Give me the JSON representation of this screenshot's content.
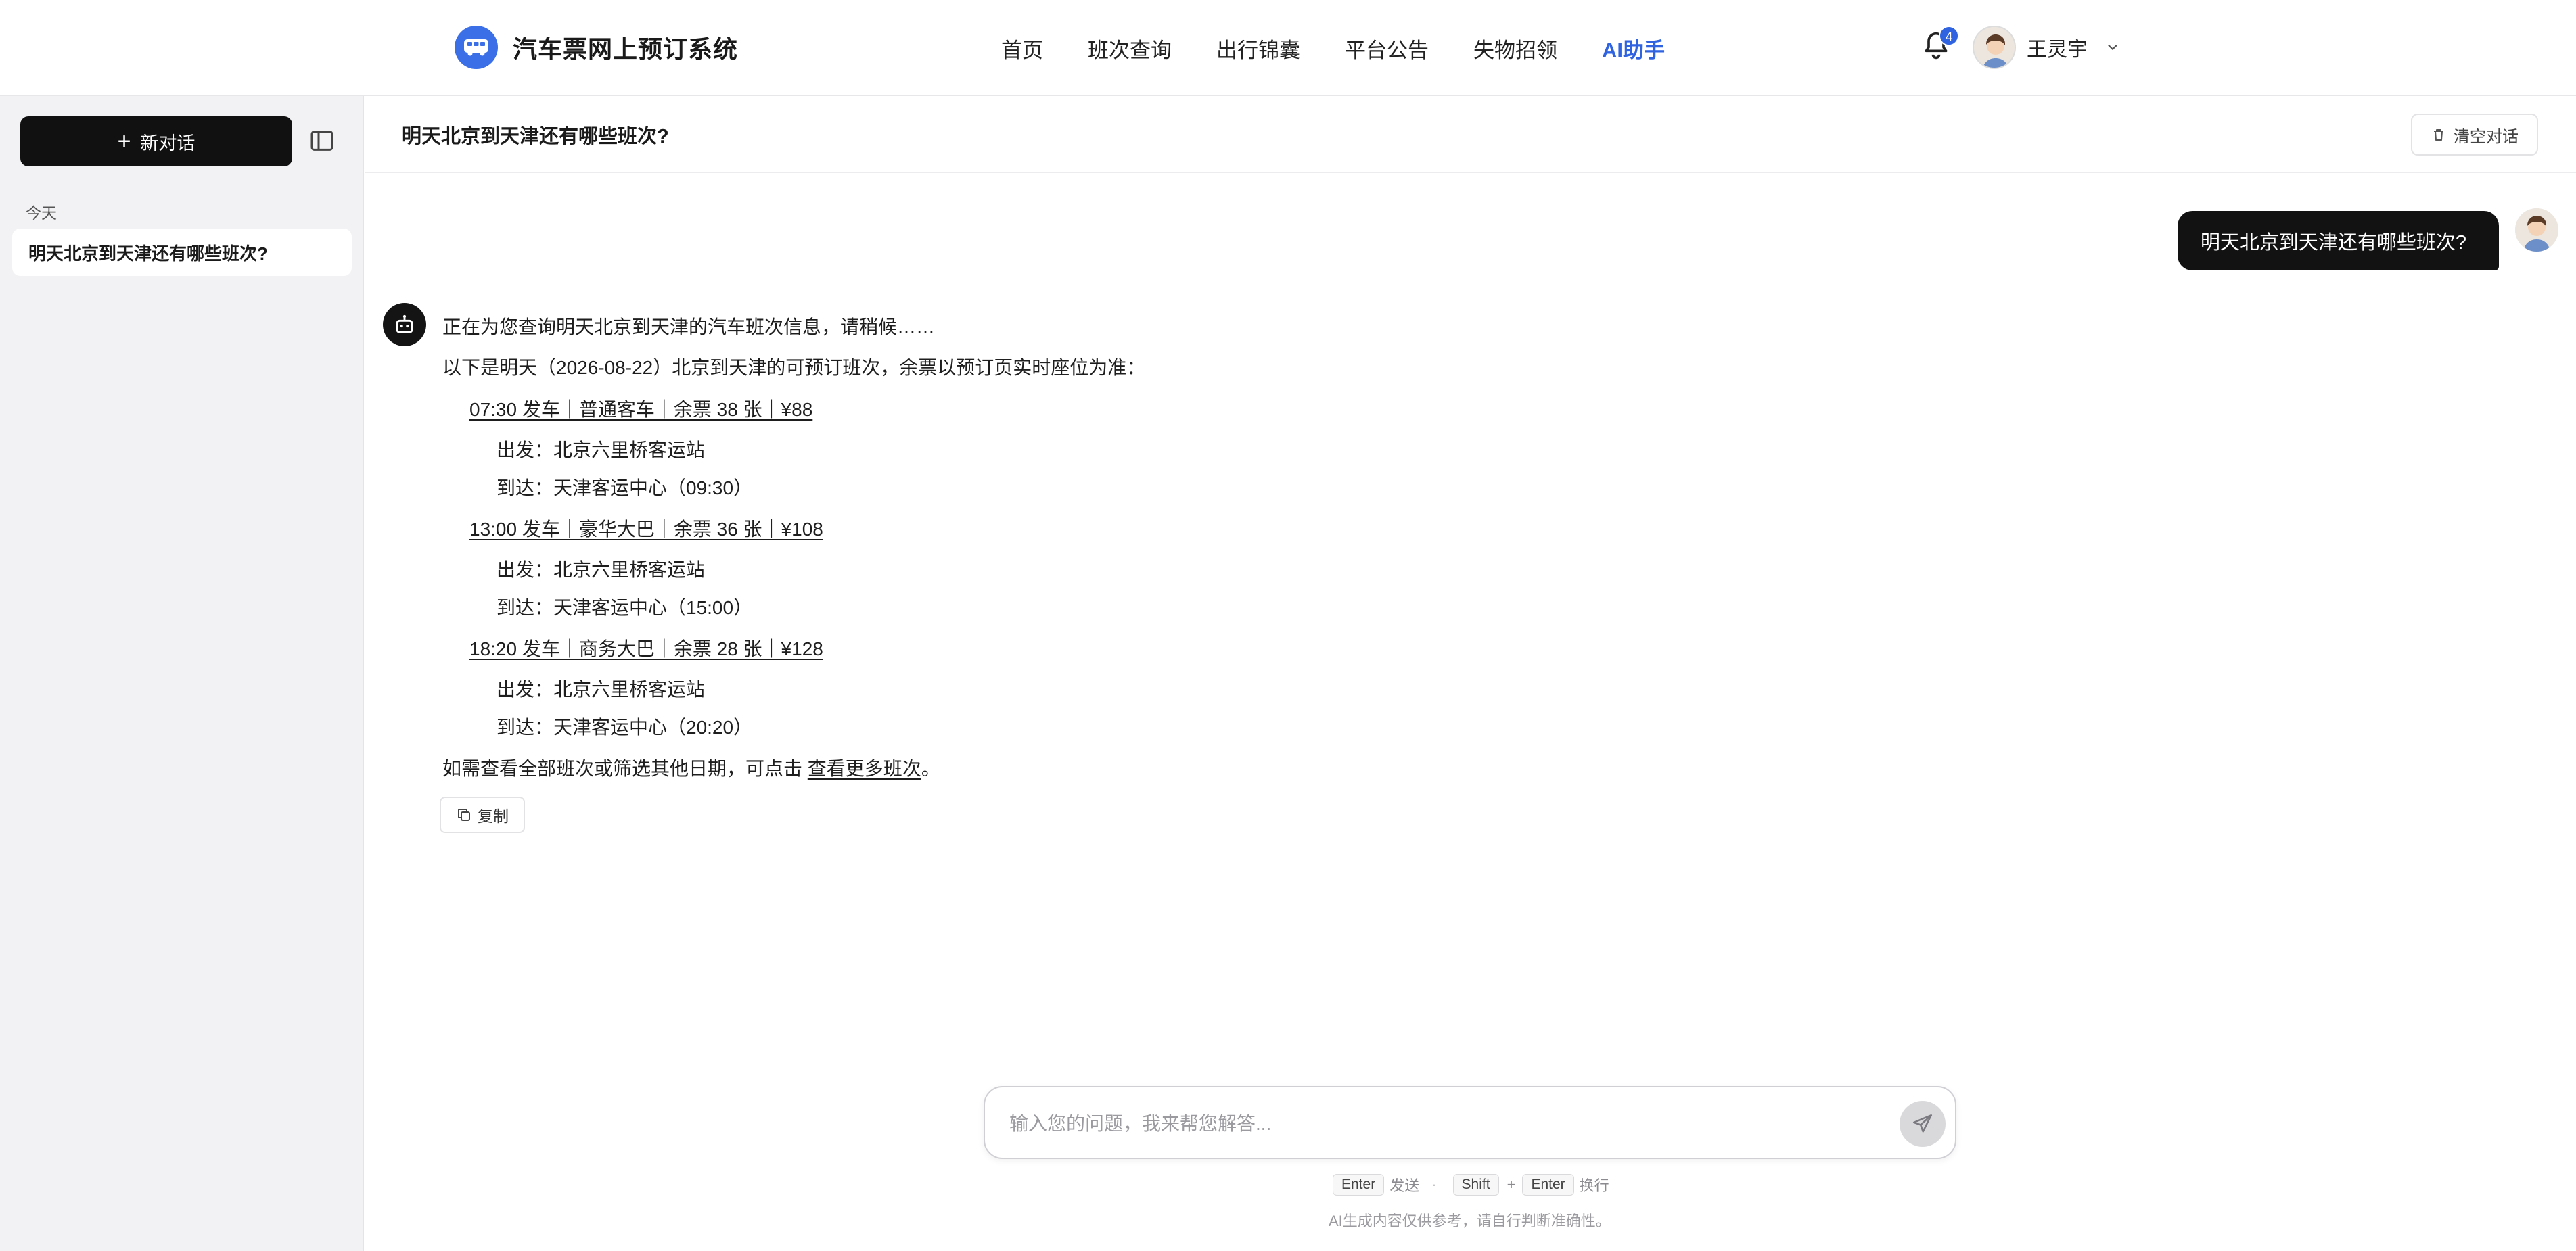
{
  "app": {
    "title": "汽车票网上预订系统"
  },
  "nav": {
    "items": [
      {
        "label": "首页",
        "active": false
      },
      {
        "label": "班次查询",
        "active": false
      },
      {
        "label": "出行锦囊",
        "active": false
      },
      {
        "label": "平台公告",
        "active": false
      },
      {
        "label": "失物招领",
        "active": false
      },
      {
        "label": "AI助手",
        "active": true
      }
    ],
    "notification_count": "4",
    "user_name": "王灵宇"
  },
  "sidebar": {
    "new_chat_label": "新对话",
    "group_label": "今天",
    "conversations": [
      {
        "title": "明天北京到天津还有哪些班次?"
      }
    ]
  },
  "chat": {
    "title": "明天北京到天津还有哪些班次?",
    "clear_label": "清空对话",
    "user_message": "明天北京到天津还有哪些班次?",
    "bot": {
      "status": "正在为您查询明天北京到天津的汽车班次信息，请稍候……",
      "intro": "以下是明天（2026-08-22）北京到天津的可预订班次，余票以预订页实时座位为准：",
      "trips": [
        {
          "summary": "07:30 发车｜普通客车｜余票 38 张｜¥88",
          "depart": "出发：北京六里桥客运站",
          "arrive": "到达：天津客运中心（09:30）"
        },
        {
          "summary": "13:00 发车｜豪华大巴｜余票 36 张｜¥108",
          "depart": "出发：北京六里桥客运站",
          "arrive": "到达：天津客运中心（15:00）"
        },
        {
          "summary": "18:20 发车｜商务大巴｜余票 28 张｜¥128",
          "depart": "出发：北京六里桥客运站",
          "arrive": "到达：天津客运中心（20:20）"
        }
      ],
      "outro_prefix": "如需查看全部班次或筛选其他日期，可点击 ",
      "outro_link": "查看更多班次",
      "outro_suffix": "。",
      "copy_label": "复制"
    }
  },
  "composer": {
    "placeholder": "输入您的问题，我来帮您解答...",
    "hint_enter_key": "Enter",
    "hint_send": "发送",
    "hint_shift_key": "Shift",
    "hint_plus": "+",
    "hint_newline": "换行",
    "disclaimer": "AI生成内容仅供参考，请自行判断准确性。"
  },
  "colors": {
    "accent": "#2f63e0",
    "brand_logo": "#3a6fe8",
    "dark_button": "#111111",
    "sidebar_bg": "#f2f2f4"
  }
}
